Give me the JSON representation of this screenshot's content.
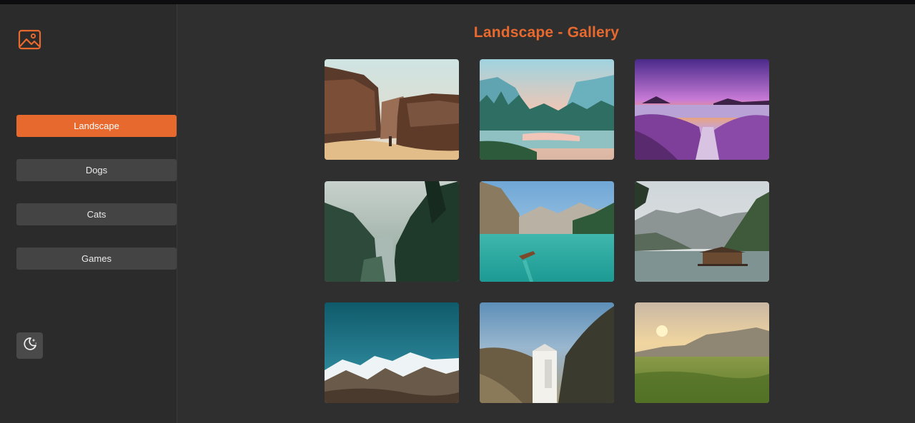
{
  "app": {
    "logo_icon": "image-gallery-icon",
    "accent_color": "#e8692e"
  },
  "sidebar": {
    "items": [
      {
        "label": "Landscape",
        "active": true
      },
      {
        "label": "Dogs",
        "active": false
      },
      {
        "label": "Cats",
        "active": false
      },
      {
        "label": "Games",
        "active": false
      }
    ],
    "theme_toggle_icon": "moon-stars-icon"
  },
  "main": {
    "title": "Landscape - Gallery",
    "photos": [
      {
        "subject": "desert canyon rocks"
      },
      {
        "subject": "forest lake at sunset"
      },
      {
        "subject": "lavender field by lake"
      },
      {
        "subject": "misty forest river"
      },
      {
        "subject": "turquoise mountain lake with boat"
      },
      {
        "subject": "lake cabin below mountains"
      },
      {
        "subject": "snowy mountains under teal sky"
      },
      {
        "subject": "water carton on mountain"
      },
      {
        "subject": "green meadow at sunrise"
      }
    ]
  }
}
